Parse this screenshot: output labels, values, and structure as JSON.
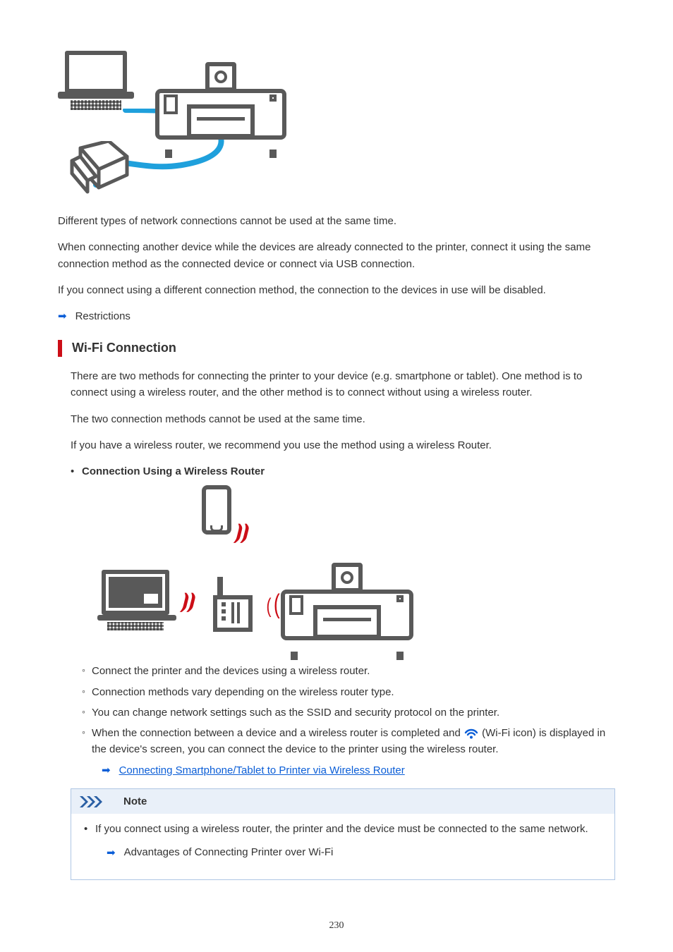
{
  "intro": {
    "p1": "Different types of network connections cannot be used at the same time.",
    "p2": "When connecting another device while the devices are already connected to the printer, connect it using the same connection method as the connected device or connect via USB connection.",
    "p3": "If you connect using a different connection method, the connection to the devices in use will be disabled.",
    "restrictions_label": "Restrictions"
  },
  "wifi": {
    "heading": "Wi-Fi Connection",
    "p1": "There are two methods for connecting the printer to your device (e.g. smartphone or tablet). One method is to connect using a wireless router, and the other method is to connect without using a wireless router.",
    "p2": "The two connection methods cannot be used at the same time.",
    "p3": "If you have a wireless router, we recommend you use the method using a wireless Router.",
    "bullet_title": "Connection Using a Wireless Router",
    "circ1": "Connect the printer and the devices using a wireless router.",
    "circ2": "Connection methods vary depending on the wireless router type.",
    "circ3": "You can change network settings such as the SSID and security protocol on the printer.",
    "circ4a": "When the connection between a device and a wireless router is completed and ",
    "circ4b": " (Wi-Fi icon) is displayed in the device's screen, you can connect the device to the printer using the wireless router.",
    "sublink": "Connecting Smartphone/Tablet to Printer via Wireless Router"
  },
  "note": {
    "label": "Note",
    "item1": "If you connect using a wireless router, the printer and the device must be connected to the same network.",
    "sublink": "Advantages of Connecting Printer over Wi-Fi"
  },
  "page_number": "230"
}
